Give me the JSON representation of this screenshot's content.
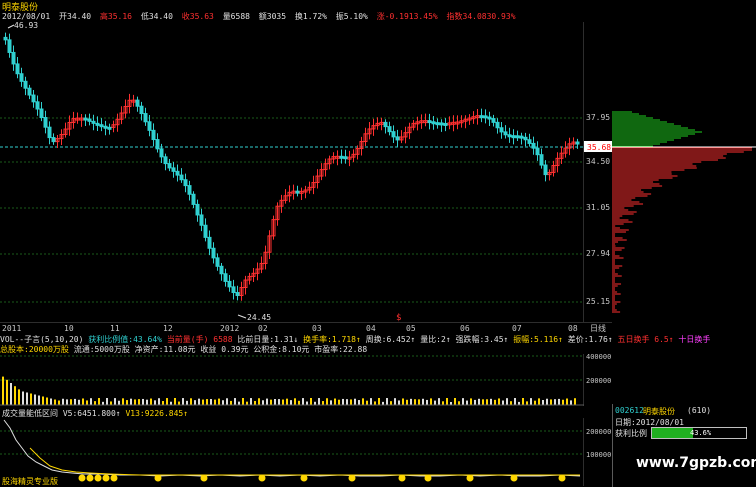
{
  "header": {
    "stock_name": "明泰股份",
    "date": "2012/08/01",
    "open": "开34.40",
    "high": "高35.16",
    "low": "低34.40",
    "close": "收35.63",
    "volume": "量6588",
    "amount": "额3035",
    "turnover": "换1.72%",
    "amplitude": "振5.10%",
    "change": "涨-0.1913.45%",
    "index": "指数34.0830.93%"
  },
  "price_axis": {
    "ticks": [
      "37.95",
      "34.50",
      "31.05",
      "27.94",
      "25.15"
    ],
    "current": "35.68",
    "max_label": "46.93",
    "min_label": "24.45",
    "marker": "$"
  },
  "date_axis": {
    "labels": [
      "2011",
      "10",
      "11",
      "12",
      "2012",
      "02",
      "03",
      "04",
      "05",
      "06",
      "07",
      "08"
    ],
    "period": "日线"
  },
  "indicator_line1": {
    "vol_title": "VOL--子言(5,10,20)",
    "profit": "获利比例值:43.64%",
    "vol_today": "当前量(手) 6588",
    "ratio": "比前日量:1.31↓",
    "turnover_rate": "换手率:1.718↑",
    "week_turnover": "周换:6.452↑",
    "vol_ratio": "量比:2↑",
    "strength": "强跌幅:3.45↑",
    "amplitude": "振幅:5.116↑",
    "spread": "差价:1.76↑",
    "five_day": "五日换手 6.5↑",
    "ten_day": "十日换手"
  },
  "indicator_line2": {
    "capital": "总股本:20000万股",
    "float": "流通:5000万股",
    "net_asset": "净资产:11.08元",
    "eps": "收益 0.39元",
    "reserve": "公积金:8.10元",
    "pe": "市盈率:22.88"
  },
  "vol_axis": {
    "ticks": [
      "400000",
      "200000"
    ]
  },
  "ind_title": {
    "name": "成交量能低区间",
    "v5": "V5:6451.800↑",
    "v13": "V13:9226.845↑"
  },
  "ind_axis": {
    "ticks": [
      "200000",
      "100000"
    ]
  },
  "side_panel": {
    "code": "002612",
    "name": "明泰股份",
    "code_suffix": "(610)",
    "date_label": "日期:2012/08/01",
    "profit_label": "获利比例",
    "profit_value": "43.6%"
  },
  "footer": {
    "text": "股海精灵专业版"
  },
  "watermark": {
    "text": "www.7gpzb.com"
  },
  "colors": {
    "up": "#ff3030",
    "down": "#30d0d0",
    "grid": "#1a5a1a",
    "yellow": "#ffd700",
    "green": "#20d020"
  }
}
